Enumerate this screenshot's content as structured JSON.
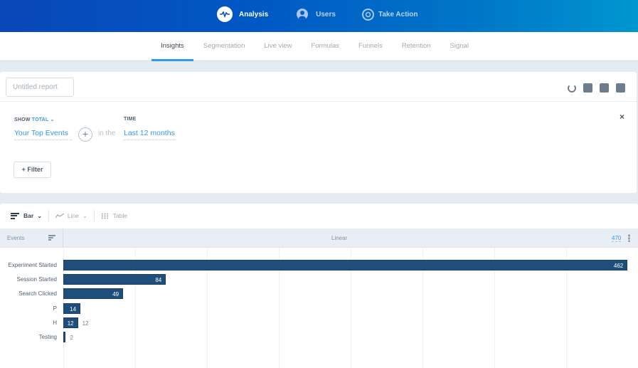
{
  "topnav": {
    "items": [
      {
        "label": "Analysis",
        "icon": "pulse-icon",
        "active": true
      },
      {
        "label": "Users",
        "icon": "user-icon",
        "active": false
      },
      {
        "label": "Take Action",
        "icon": "target-icon",
        "active": false
      }
    ]
  },
  "tabs": [
    {
      "label": "Insights",
      "active": true
    },
    {
      "label": "Segmentation"
    },
    {
      "label": "Live view"
    },
    {
      "label": "Formulas"
    },
    {
      "label": "Funnels"
    },
    {
      "label": "Retention"
    },
    {
      "label": "Signal"
    }
  ],
  "report": {
    "title_placeholder": "Untitled report",
    "toolbar_icons": [
      "refresh-icon",
      "export-icon",
      "save-icon",
      "add-to-dashboard-icon"
    ]
  },
  "query": {
    "show_label": "SHOW",
    "show_value": "TOTAL",
    "events_value": "Your Top Events",
    "connector": "in the",
    "time_label": "TIME",
    "time_value": "Last 12 months",
    "filter_button": "+ Filter",
    "close_glyph": "×"
  },
  "view": {
    "tabs": [
      {
        "label": "Bar",
        "active": true,
        "has_dropdown": true
      },
      {
        "label": "Line",
        "active": false,
        "has_dropdown": true
      },
      {
        "label": "Table",
        "active": false
      }
    ],
    "header": {
      "events_col": "Events",
      "scale": "Linear",
      "max_value": "470"
    }
  },
  "accent_color": "#3398e6",
  "bar_color": "#1f4e7b",
  "chart_data": {
    "type": "bar",
    "orientation": "horizontal",
    "title": "",
    "xlabel": "Linear",
    "ylabel": "Events",
    "xlim": [
      0,
      470
    ],
    "grid": true,
    "categories": [
      "Experiment Started",
      "Session Started",
      "Search Clicked",
      "P",
      "H",
      "Testing"
    ],
    "values": [
      462,
      84,
      49,
      14,
      12,
      2
    ],
    "outside_labels": {
      "H": "12",
      "Testing": "2"
    }
  }
}
